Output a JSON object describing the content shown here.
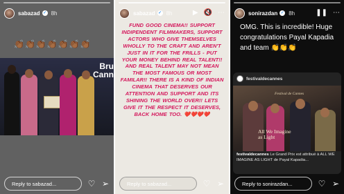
{
  "stories": [
    {
      "username": "sabazad",
      "time": "8h",
      "emoji_row": "👏🏾👏🏾👏🏾👏🏾👏🏾👏🏾👏🏾",
      "photo_text": "Bru\nCanne",
      "reply_placeholder": "Reply to sabazad..."
    },
    {
      "username": "sabazad",
      "time": "8h",
      "body": "FUND GOOD CINEMA!! SUPPORT INDIPENDENT FILMMAKERS, SUPPORT ACTORS WHO GIVE THEMSELVES WHOLLY TO THE CRAFT AND AREN'T JUST IN IT FOR THE FRILLS - PUT YOUR MONEY BEHIND REAL TALENT!! AND REAL TALENT MAY NOT MEAN THE MOST FAMOUS OR MOST FAMILAR!! THERE IS A KIND OF INDIAN CINEMA THAT DESERVES OUR ATTENTION AND SUPPORT AND ITS SHINING THE WORLD OVER!! LETS GIVE IT THE RESPECT IT DESERVES, BACK HOME TOO. ❤️❤️❤️❤️",
      "reply_placeholder": "Reply to sabazad..."
    },
    {
      "username": "sonirazdan",
      "time": "8h",
      "body": "OMG. This is incredible! Huge congratulations Payal Kapadia and team 👏👏👏",
      "card": {
        "account": "festivaldecannes",
        "logo_text": "Festival de Cannes",
        "image_title": "All We Imagine\nas Light",
        "caption_account": "festivaldecannes",
        "caption_text": "Le Grand Prix est attribué à ALL WE IMAGINE AS LIGHT de Payal Kapadia..."
      },
      "reply_placeholder": "Reply to sonirazdan..."
    }
  ],
  "colors": {
    "panel2_text": "#d4185c",
    "panel3_bg": "#0e0e0e",
    "verified": "#3897f0"
  },
  "icons": [
    "verified-badge-icon",
    "play-icon",
    "pause-icon",
    "mute-icon",
    "more-icon",
    "heart-icon",
    "send-icon"
  ]
}
